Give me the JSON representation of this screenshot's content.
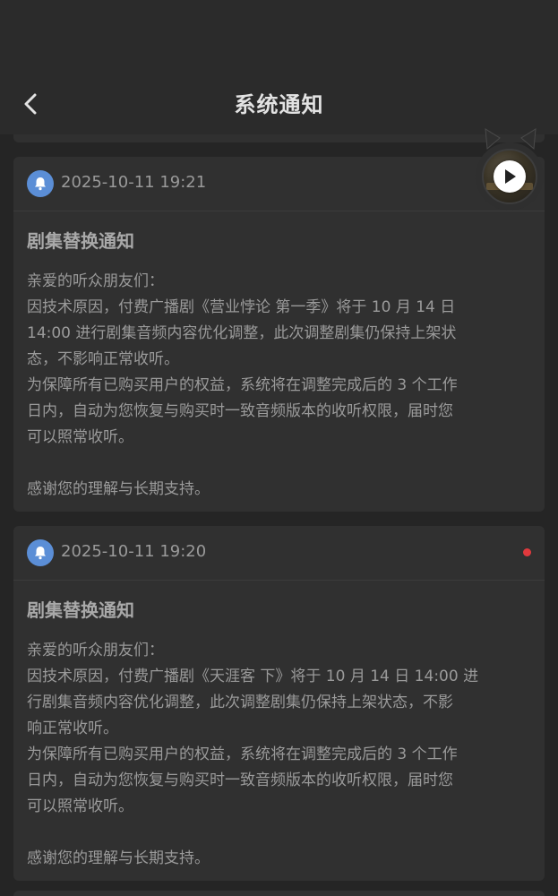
{
  "header": {
    "title": "系统通知"
  },
  "notifications": [
    {
      "time": "2025-10-11 19:21",
      "title": "剧集替换通知",
      "unread": false,
      "lines": [
        "亲爱的听众朋友们：",
        "因技术原因，付费广播剧《营业悖论 第一季》将于 10 月 14 日",
        "14:00 进行剧集音频内容优化调整，此次调整剧集仍保持上架状",
        "态，不影响正常收听。",
        "为保障所有已购买用户的权益，系统将在调整完成后的 3 个工作",
        "日内，自动为您恢复与购买时一致音频版本的收听权限，届时您",
        "可以照常收听。",
        "",
        "感谢您的理解与长期支持。"
      ]
    },
    {
      "time": "2025-10-11 19:20",
      "title": "剧集替换通知",
      "unread": true,
      "lines": [
        "亲爱的听众朋友们：",
        "因技术原因，付费广播剧《天涯客 下》将于 10 月 14 日 14:00 进",
        "行剧集音频内容优化调整，此次调整剧集仍保持上架状态，不影",
        "响正常收听。",
        "为保障所有已购买用户的权益，系统将在调整完成后的 3 个工作",
        "日内，自动为您恢复与购买时一致音频版本的收听权限，届时您",
        "可以照常收听。",
        "",
        "感谢您的理解与长期支持。"
      ]
    }
  ],
  "icons": {
    "back": "chevron-left-icon",
    "notice": "bell-icon",
    "player": "play-icon"
  },
  "colors": {
    "background": "#252525",
    "card": "#303030",
    "bell_badge": "#5b8ed6",
    "unread_dot": "#e0393d"
  }
}
